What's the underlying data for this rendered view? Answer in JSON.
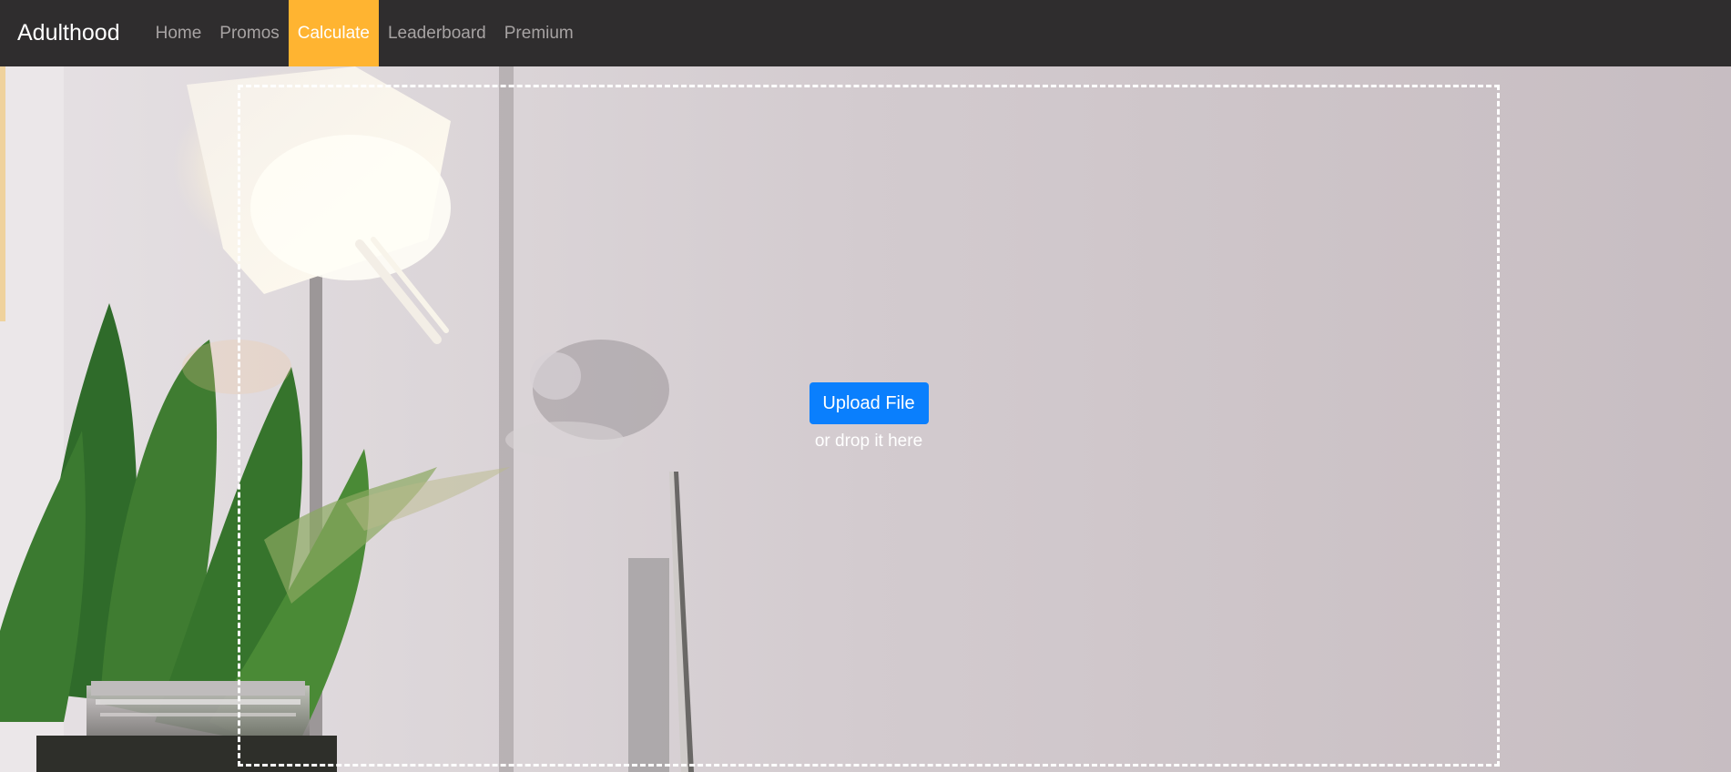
{
  "navbar": {
    "brand": "Adulthood",
    "items": [
      {
        "label": "Home",
        "active": false
      },
      {
        "label": "Promos",
        "active": false
      },
      {
        "label": "Calculate",
        "active": true
      },
      {
        "label": "Leaderboard",
        "active": false
      },
      {
        "label": "Premium",
        "active": false
      }
    ]
  },
  "upload": {
    "button_label": "Upload File",
    "hint": "or drop it here"
  },
  "colors": {
    "navbar_bg": "#2f2d2e",
    "active_tab": "#ffb431",
    "upload_button": "#0a7ffd"
  }
}
